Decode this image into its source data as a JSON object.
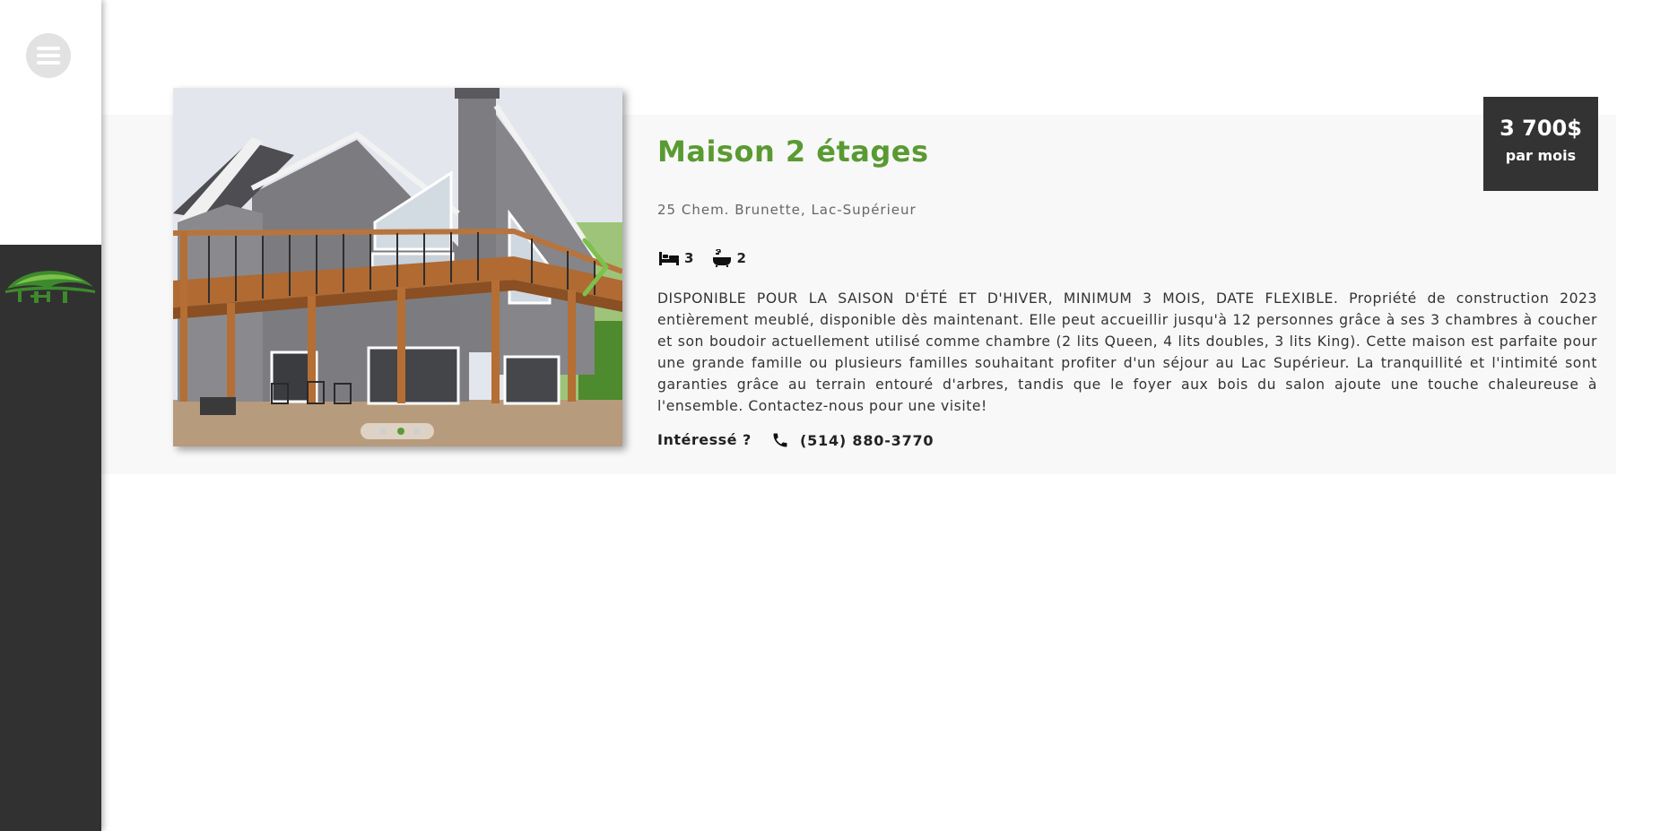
{
  "nav": {
    "menu_icon": "hamburger-menu-icon",
    "logo_icon": "green-bridge-logo-icon"
  },
  "listing": {
    "title": "Maison 2 étages",
    "address": "25 Chem. Brunette, Lac-Supérieur",
    "bedrooms": "3",
    "bathrooms": "2",
    "bed_icon": "bed-icon",
    "bath_icon": "bathtub-icon",
    "description": "DISPONIBLE POUR LA SAISON D'ÉTÉ ET D'HIVER, MINIMUM 3 MOIS, DATE FLEXIBLE. Propriété de construction 2023 entièrement meublé, disponible dès maintenant. Elle peut accueillir jusqu'à 12 personnes grâce à ses 3 chambres à coucher et son boudoir actuellement utilisé comme chambre (2 lits Queen, 4 lits doubles, 3 lits King). Cette maison est parfaite pour une grande famille ou plusieurs familles souhaitant profiter d'un séjour au Lac Supérieur. La tranquillité et l'intimité sont garanties grâce au terrain entouré d'arbres, tandis que le foyer aux bois du salon ajoute une touche chaleureuse à l'ensemble. Contactez-nous pour une visite!",
    "interest_label": "Intéressé ?",
    "phone": "(514) 880-3770",
    "phone_icon": "phone-icon",
    "price_amount": "3 700$",
    "price_period": "par mois",
    "carousel": {
      "slide_count": 3,
      "active_slide": 2,
      "next_icon": "chevron-right-icon"
    }
  },
  "colors": {
    "accent_green": "#5a9a32",
    "sidebar_dark": "#313131",
    "price_box": "#333333",
    "band_background": "#f8f8f8",
    "active_dot": "#5a9a32"
  }
}
